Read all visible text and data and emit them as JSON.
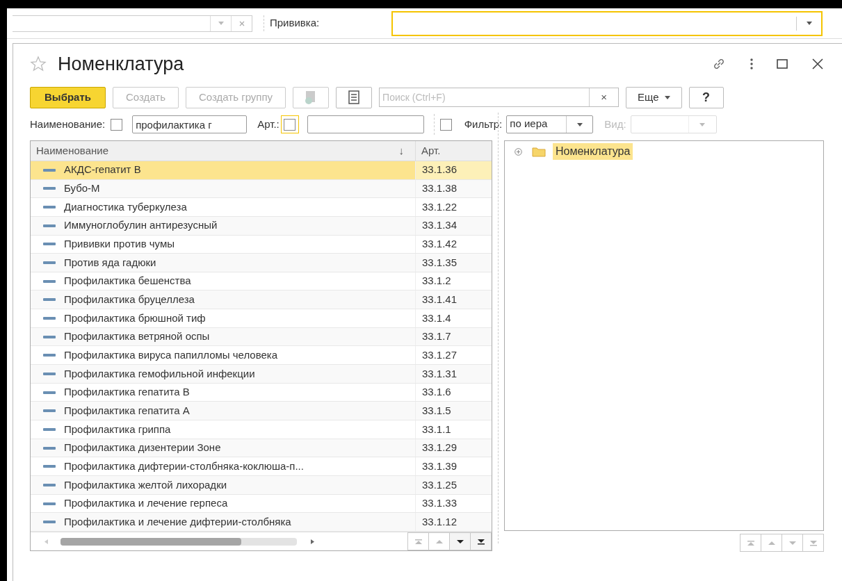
{
  "top_bar": {
    "label": "Прививка:"
  },
  "dialog": {
    "title": "Номенклатура",
    "favorite": false
  },
  "toolbar": {
    "buttons": [
      {
        "label": "Выбрать",
        "kind": "primary",
        "disabled": false
      },
      {
        "label": "Создать",
        "kind": "text",
        "disabled": true
      },
      {
        "label": "Создать группу",
        "kind": "text",
        "disabled": true
      },
      {
        "kind": "copy-icon",
        "disabled": true
      },
      {
        "kind": "list-icon",
        "disabled": false
      }
    ],
    "search": {
      "placeholder": "Поиск (Ctrl+F)",
      "clear": "×"
    },
    "more": "Еще",
    "help": "?"
  },
  "filters": {
    "name_label": "Наименование:",
    "name_checked": false,
    "name_value": "профилактика г",
    "art_label": "Арт.:",
    "art_checked": false,
    "filter_checked": false,
    "filter_label": "Фильтр:",
    "filter_value": "по иерa",
    "view_label": "Вид:"
  },
  "table": {
    "columns": [
      {
        "label": "Наименование",
        "sort": "↓"
      },
      {
        "label": "Арт."
      }
    ],
    "rows": [
      {
        "name": "АКДС-гепатит В",
        "art": "33.1.36",
        "selected": true
      },
      {
        "name": "Бубо-М",
        "art": "33.1.38",
        "selected": false
      },
      {
        "name": "Диагностика туберкулеза",
        "art": "33.1.22",
        "selected": false
      },
      {
        "name": "Иммуноглобулин антирезусный",
        "art": "33.1.34",
        "selected": false
      },
      {
        "name": "Прививки против чумы",
        "art": "33.1.42",
        "selected": false
      },
      {
        "name": "Против яда гадюки",
        "art": "33.1.35",
        "selected": false
      },
      {
        "name": "Профилактика бешенства",
        "art": "33.1.2",
        "selected": false
      },
      {
        "name": "Профилактика бруцеллеза",
        "art": "33.1.41",
        "selected": false
      },
      {
        "name": "Профилактика брюшной тиф",
        "art": "33.1.4",
        "selected": false
      },
      {
        "name": "Профилактика ветряной оспы",
        "art": "33.1.7",
        "selected": false
      },
      {
        "name": "Профилактика вируса папилломы человека",
        "art": "33.1.27",
        "selected": false
      },
      {
        "name": "Профилактика гемофильной инфекции",
        "art": "33.1.31",
        "selected": false
      },
      {
        "name": "Профилактика гепатита В",
        "art": "33.1.6",
        "selected": false
      },
      {
        "name": "Профилактика гепатита А",
        "art": "33.1.5",
        "selected": false
      },
      {
        "name": "Профилактика гриппа",
        "art": "33.1.1",
        "selected": false
      },
      {
        "name": "Профилактика дизентерии Зоне",
        "art": "33.1.29",
        "selected": false
      },
      {
        "name": "Профилактика дифтерии-столбняка-коклюша-п...",
        "art": "33.1.39",
        "selected": false
      },
      {
        "name": "Профилактика желтой лихорадки",
        "art": "33.1.25",
        "selected": false
      },
      {
        "name": "Профилактика и лечение герпеса",
        "art": "33.1.33",
        "selected": false
      },
      {
        "name": "Профилактика и лечение дифтерии-столбняка",
        "art": "33.1.12",
        "selected": false
      }
    ],
    "nav": [
      {
        "kind": "first",
        "disabled": true
      },
      {
        "kind": "up",
        "disabled": true
      },
      {
        "kind": "down",
        "disabled": false
      },
      {
        "kind": "last",
        "disabled": false
      }
    ]
  },
  "tree": {
    "items": [
      {
        "label": "Номенклатура",
        "selected": true,
        "expanded": false
      }
    ],
    "nav": [
      {
        "kind": "first",
        "disabled": true
      },
      {
        "kind": "up",
        "disabled": true
      },
      {
        "kind": "down",
        "disabled": true
      },
      {
        "kind": "last",
        "disabled": true
      }
    ]
  }
}
